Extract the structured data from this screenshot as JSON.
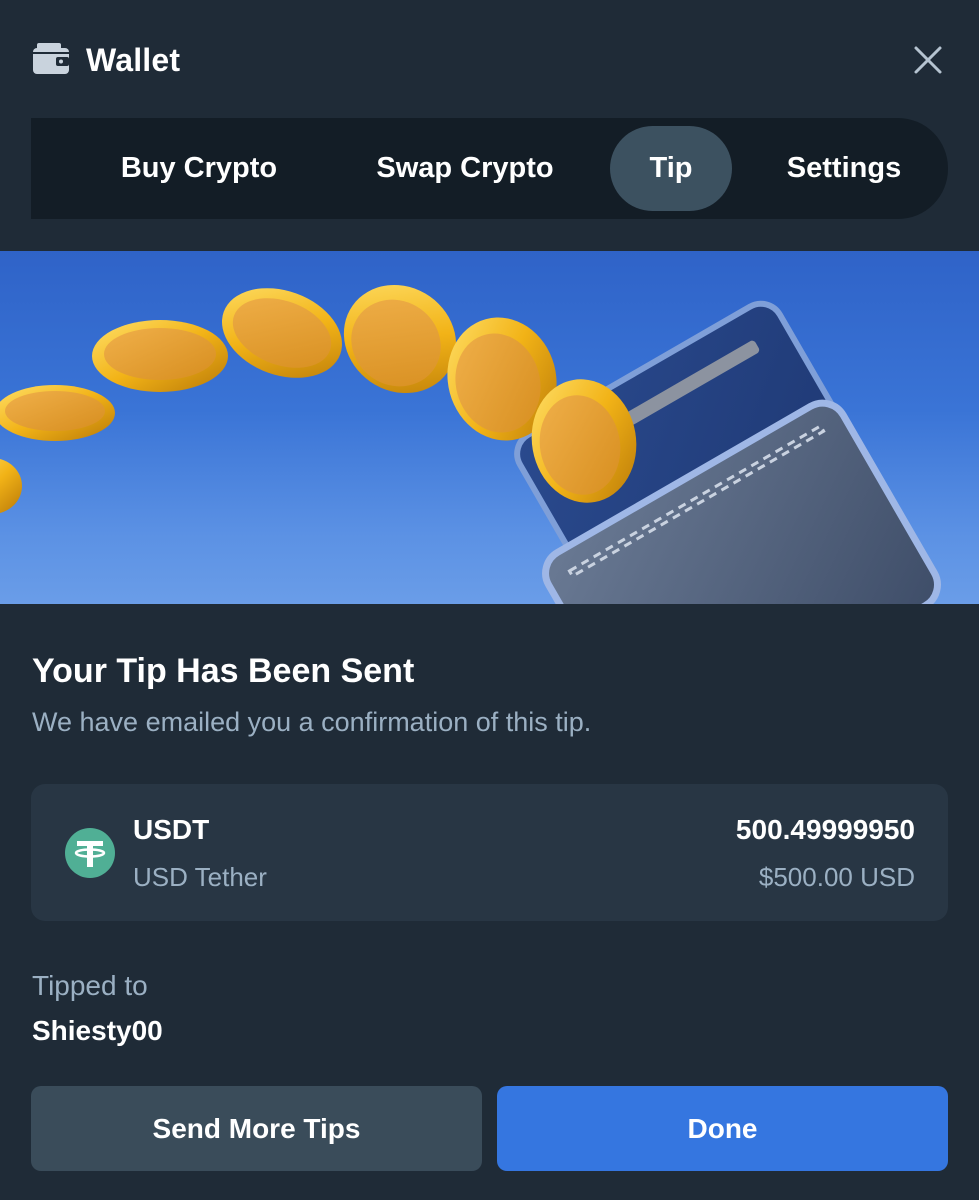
{
  "header": {
    "title": "Wallet",
    "wallet_icon": "wallet-icon",
    "close_icon": "close-icon"
  },
  "tabs": [
    {
      "label": "Buy Crypto",
      "active": false
    },
    {
      "label": "Swap Crypto",
      "active": false
    },
    {
      "label": "Tip",
      "active": true
    },
    {
      "label": "Settings",
      "active": false
    }
  ],
  "confirmation": {
    "heading": "Your Tip Has Been Sent",
    "subheading": "We have emailed you a confirmation of this tip."
  },
  "asset": {
    "icon": "tether-icon",
    "symbol": "USDT",
    "name": "USD Tether",
    "amount": "500.49999950",
    "usd_value": "$500.00 USD"
  },
  "recipient": {
    "label": "Tipped to",
    "username": "Shiesty00"
  },
  "actions": {
    "send_more": "Send More Tips",
    "done": "Done"
  },
  "colors": {
    "background": "#1f2b37",
    "tab_bar": "#131d26",
    "active_tab": "#3c5160",
    "card": "#283644",
    "muted_text": "#9bb0c3",
    "primary_button": "#3576e0",
    "secondary_button": "#3a4c5a",
    "tether_green": "#50af95"
  }
}
